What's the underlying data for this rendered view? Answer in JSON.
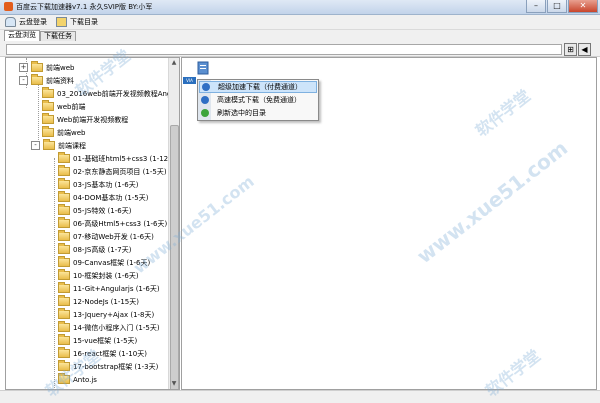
{
  "window": {
    "title": "百度云下载加速器v7.1 永久SVIP版 BY:小军"
  },
  "toolbar": {
    "login_label": "云盘登录",
    "download_dir_label": "下载目录"
  },
  "tabs": [
    {
      "label": "云盘浏览",
      "active": true
    },
    {
      "label": "下载任务",
      "active": false
    }
  ],
  "path": {
    "value": ""
  },
  "tree": {
    "items": [
      {
        "label": "前端web",
        "depth": 1,
        "expander": "+"
      },
      {
        "label": "前端资料",
        "depth": 1,
        "expander": "-"
      },
      {
        "label": "03_2016web前端开发视频教程Angu",
        "depth": 2,
        "expander": ""
      },
      {
        "label": "web前端",
        "depth": 2,
        "expander": ""
      },
      {
        "label": "Web前端开发视频教程",
        "depth": 2,
        "expander": ""
      },
      {
        "label": "前端web",
        "depth": 2,
        "expander": ""
      },
      {
        "label": "前端课程",
        "depth": 2,
        "expander": "-"
      },
      {
        "label": "01-基础班html5+css3 (1-12",
        "depth": 3,
        "expander": ""
      },
      {
        "label": "02-京东静态网页项目 (1-5天)",
        "depth": 3,
        "expander": ""
      },
      {
        "label": "03-JS基本功 (1-6天)",
        "depth": 3,
        "expander": ""
      },
      {
        "label": "04-DOM基本功 (1-5天)",
        "depth": 3,
        "expander": ""
      },
      {
        "label": "05-JS特效 (1-6天)",
        "depth": 3,
        "expander": ""
      },
      {
        "label": "06-高级Html5+css3 (1-6天)",
        "depth": 3,
        "expander": ""
      },
      {
        "label": "07-移动Web开发 (1-6天)",
        "depth": 3,
        "expander": ""
      },
      {
        "label": "08-JS高级 (1-7天)",
        "depth": 3,
        "expander": ""
      },
      {
        "label": "09-Canvas框架 (1-6天)",
        "depth": 3,
        "expander": ""
      },
      {
        "label": "10-框架封装 (1-6天)",
        "depth": 3,
        "expander": ""
      },
      {
        "label": "11-Git+Angularjs (1-6天)",
        "depth": 3,
        "expander": ""
      },
      {
        "label": "12-NodeJs (1-15天)",
        "depth": 3,
        "expander": ""
      },
      {
        "label": "13-Jquery+Ajax (1-8天)",
        "depth": 3,
        "expander": ""
      },
      {
        "label": "14-微信小程序入门 (1-5天)",
        "depth": 3,
        "expander": ""
      },
      {
        "label": "15-vue框架 (1-5天)",
        "depth": 3,
        "expander": ""
      },
      {
        "label": "16-react框架 (1-10天)",
        "depth": 3,
        "expander": ""
      },
      {
        "label": "17-bootstrap框架 (1-3天)",
        "depth": 3,
        "expander": ""
      },
      {
        "label": "Anto.js",
        "depth": 3,
        "expander": ""
      }
    ]
  },
  "context_menu": {
    "items": [
      {
        "label": "超级加速下载（付费通道）",
        "icon": "super-download-icon",
        "color": "#2f6fc4"
      },
      {
        "label": "高速模式下载（免费通道）",
        "icon": "fast-download-icon",
        "color": "#2f6fc4"
      },
      {
        "label": "刷新选中的目录",
        "icon": "refresh-icon",
        "color": "#3ca43c"
      }
    ]
  },
  "file_area": {
    "badge": "VIA"
  },
  "watermark": {
    "text": "软件学堂",
    "url": "www.xue51.com"
  },
  "colors": {
    "title_bg": "#c2d3ea",
    "highlight": "#cde4fa",
    "folder": "#e9bd4b"
  }
}
